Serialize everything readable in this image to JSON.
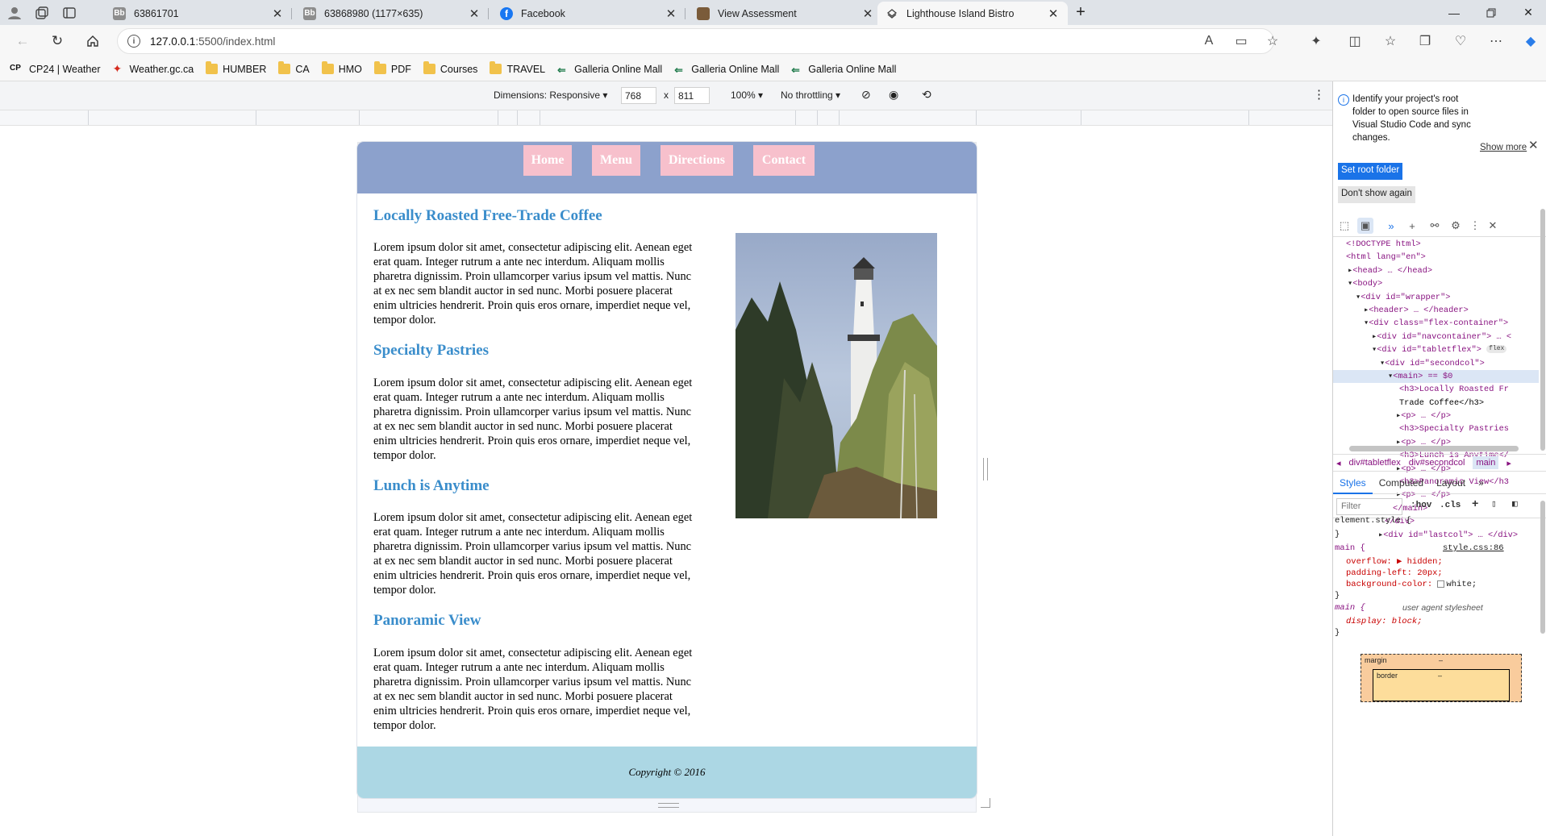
{
  "tabs": [
    {
      "label": "63861701",
      "icon": "Bb"
    },
    {
      "label": "63868980 (1177×635)",
      "icon": "Bb"
    },
    {
      "label": "Facebook",
      "icon": "f"
    },
    {
      "label": "View Assessment",
      "icon": "book"
    },
    {
      "label": "Lighthouse Island Bistro",
      "icon": "tab"
    }
  ],
  "address": {
    "host": "127.0.0.1",
    "path": ":5500/index.html"
  },
  "bookmarks": [
    {
      "label": "CP24 | Weather",
      "icon": "cp24-icon"
    },
    {
      "label": "Weather.gc.ca",
      "icon": "maple-leaf-icon"
    },
    {
      "label": "HUMBER",
      "icon": "folder-icon"
    },
    {
      "label": "CA",
      "icon": "folder-icon"
    },
    {
      "label": "HMO",
      "icon": "folder-icon"
    },
    {
      "label": "PDF",
      "icon": "folder-icon"
    },
    {
      "label": "Courses",
      "icon": "folder-icon"
    },
    {
      "label": "TRAVEL",
      "icon": "folder-icon"
    },
    {
      "label": "Galleria Online Mall",
      "icon": "galleria-icon"
    },
    {
      "label": "Galleria Online Mall",
      "icon": "galleria-icon"
    },
    {
      "label": "Galleria Online Mall",
      "icon": "galleria-icon"
    }
  ],
  "device_toolbar": {
    "dimensions": "Dimensions: Responsive",
    "width": "768",
    "times": "x",
    "height": "811",
    "zoom": "100%",
    "throttling": "No throttling"
  },
  "site": {
    "nav": [
      "Home",
      "Menu",
      "Directions",
      "Contact"
    ],
    "sections": [
      {
        "title": "Locally Roasted Free-Trade Coffee",
        "body": "Lorem ipsum dolor sit amet, consectetur adipiscing elit. Aenean eget erat quam. Integer rutrum a ante nec interdum. Aliquam mollis pharetra dignissim. Proin ullamcorper varius ipsum vel mattis. Nunc at ex nec sem blandit auctor in sed nunc. Morbi posuere placerat enim ultricies hendrerit. Proin quis eros ornare, imperdiet neque vel, tempor dolor."
      },
      {
        "title": "Specialty Pastries",
        "body": "Lorem ipsum dolor sit amet, consectetur adipiscing elit. Aenean eget erat quam. Integer rutrum a ante nec interdum. Aliquam mollis pharetra dignissim. Proin ullamcorper varius ipsum vel mattis. Nunc at ex nec sem blandit auctor in sed nunc. Morbi posuere placerat enim ultricies hendrerit. Proin quis eros ornare, imperdiet neque vel, tempor dolor."
      },
      {
        "title": "Lunch is Anytime",
        "body": "Lorem ipsum dolor sit amet, consectetur adipiscing elit. Aenean eget erat quam. Integer rutrum a ante nec interdum. Aliquam mollis pharetra dignissim. Proin ullamcorper varius ipsum vel mattis. Nunc at ex nec sem blandit auctor in sed nunc. Morbi posuere placerat enim ultricies hendrerit. Proin quis eros ornare, imperdiet neque vel, tempor dolor."
      },
      {
        "title": "Panoramic View",
        "body": "Lorem ipsum dolor sit amet, consectetur adipiscing elit. Aenean eget erat quam. Integer rutrum a ante nec interdum. Aliquam mollis pharetra dignissim. Proin ullamcorper varius ipsum vel mattis. Nunc at ex nec sem blandit auctor in sed nunc. Morbi posuere placerat enim ultricies hendrerit. Proin quis eros ornare, imperdiet neque vel, tempor dolor."
      }
    ],
    "footer": "Copyright © 2016",
    "colors": {
      "header": "#8ca1cc",
      "nav_button": "#f7c0cc",
      "heading": "#3a8dcb",
      "footer": "#acd7e4"
    }
  },
  "devtools": {
    "notice": "Identify your project's root folder to open source files in Visual Studio Code and sync changes.",
    "show_more": "Show more",
    "set_root": "Set root folder",
    "dont_show": "Don't show again",
    "dom_lines": [
      "<!DOCTYPE html>",
      "<html lang=\"en\">",
      "<head> … </head>",
      "<body>",
      "<div id=\"wrapper\">",
      "<header> … </header>",
      "<div class=\"flex-container\">",
      "<div id=\"navcontainer\"> … <",
      "<div id=\"tabletflex\">",
      "<div id=\"secondcol\">",
      "<main> == $0",
      "<h3>Locally Roasted Fr",
      "Trade Coffee</h3>",
      "<p> … </p>",
      "<h3>Specialty Pastries",
      "<p> … </p>",
      "<h3>Lunch is Anytime</",
      "<p> … </p>",
      "<h3>Panoramic View</h3",
      "<p> … </p>",
      "</main>",
      "</div>",
      "<div id=\"lastcol\"> … </div>"
    ],
    "flex_badge": "flex",
    "breadcrumbs": [
      "div#tabletflex",
      "div#secondcol",
      "main"
    ],
    "style_tabs": [
      "Styles",
      "Computed",
      "Layout"
    ],
    "filter_placeholder": "Filter",
    "hov": ":hov",
    "cls": ".cls",
    "rules": {
      "element_style": "element.style {",
      "close": "}",
      "main_selector": "main {",
      "main_source": "style.css:86",
      "overflow": "overflow: ▶ hidden;",
      "padding": "padding-left: 20px;",
      "bg": "background-color: ",
      "bg_value": "white;",
      "ua_selector": "main {",
      "ua_label": "user agent stylesheet",
      "display": "display: block;"
    },
    "box_margin": "margin",
    "box_border": "border",
    "box_dash": "–"
  }
}
